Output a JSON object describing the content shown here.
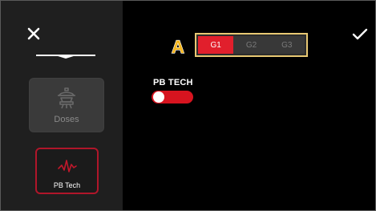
{
  "sidebar": {
    "items": [
      {
        "label": "Doses",
        "icon": "dispenser-icon",
        "enabled": false
      },
      {
        "label": "PB Tech",
        "icon": "waveform-icon",
        "selected": true
      }
    ]
  },
  "header": {
    "close_icon": "close-icon",
    "confirm_icon": "check-icon",
    "callout_label": "A"
  },
  "group_selector": {
    "options": [
      "G1",
      "G2",
      "G3"
    ],
    "selected": "G1"
  },
  "pb_tech_toggle": {
    "label": "PB TECH",
    "on": false
  },
  "colors": {
    "accent_red": "#e11f2c",
    "callout_yellow": "#f4b51c",
    "frame_gold": "#e8c873",
    "sidebar_bg": "#1f1f1f",
    "screen_bg": "#000000"
  }
}
